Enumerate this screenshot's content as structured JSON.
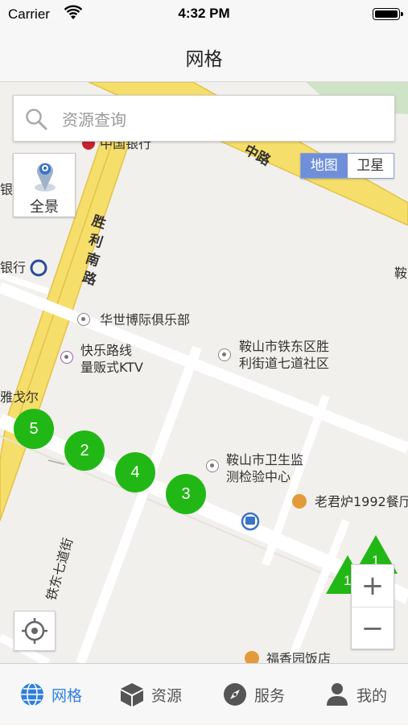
{
  "status_bar": {
    "carrier": "Carrier",
    "time": "4:32 PM"
  },
  "nav": {
    "title": "网格"
  },
  "search": {
    "placeholder": "资源查询"
  },
  "panorama": {
    "label": "全景"
  },
  "map_type": {
    "options": [
      "地图",
      "卫星"
    ],
    "selected": "地图"
  },
  "map": {
    "roads": [
      {
        "label_chars": [
          "胜",
          "利",
          "南",
          "路"
        ]
      },
      {
        "label": "中路"
      },
      {
        "label": "铁东七道街"
      }
    ],
    "pois": [
      {
        "label": "中国银行"
      },
      {
        "label": "银行"
      },
      {
        "label": "华世博际俱乐部"
      },
      {
        "label_lines": [
          "快乐路线",
          "量贩式KTV"
        ]
      },
      {
        "label_lines": [
          "鞍山市铁东区胜",
          "利街道七道社区"
        ]
      },
      {
        "label": "雅戈尔"
      },
      {
        "label_lines": [
          "鞍山市卫生监",
          "测检验中心"
        ]
      },
      {
        "label": "老君炉1992餐厅"
      },
      {
        "label": "福香园饭店"
      },
      {
        "label": "鞍"
      },
      {
        "label": "银"
      }
    ],
    "clusters": [
      "5",
      "2",
      "4",
      "3"
    ],
    "triangle_markers": [
      "1",
      "1"
    ],
    "colors": {
      "marker": "#21b815",
      "road_major": "#f7e27a",
      "accent": "#2f7fe0"
    }
  },
  "zoom": {
    "in_label": "+",
    "out_label": "−"
  },
  "tabs": [
    {
      "label": "网格",
      "icon": "globe-icon",
      "active": true
    },
    {
      "label": "资源",
      "icon": "cube-icon",
      "active": false
    },
    {
      "label": "服务",
      "icon": "compass-icon",
      "active": false
    },
    {
      "label": "我的",
      "icon": "person-icon",
      "active": false
    }
  ]
}
